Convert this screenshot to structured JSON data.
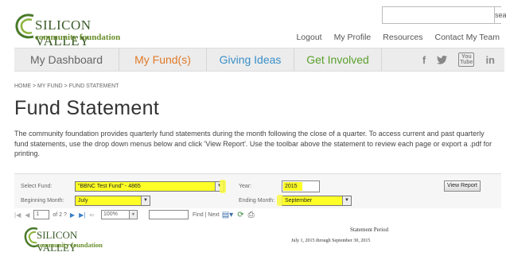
{
  "header": {
    "search_button": "search",
    "logo_line1": "SILICON VALLEY",
    "logo_line2": "community foundation",
    "top_links": [
      "Logout",
      "My Profile",
      "Resources",
      "Contact My Team"
    ]
  },
  "nav": {
    "items": [
      "My Dashboard",
      "My Fund(s)",
      "Giving Ideas",
      "Get Involved"
    ],
    "social": [
      "facebook-icon",
      "twitter-icon",
      "youtube-icon",
      "linkedin-icon"
    ]
  },
  "breadcrumb": "HOME > MY FUND > FUND STATEMENT",
  "page": {
    "title": "Fund Statement",
    "intro": "The community foundation provides quarterly fund statements during the month following the close of a quarter.  To access current and past quarterly fund statements, use the drop down menus below and click 'View Report'.  Use the toolbar above the statement to review each page or export a .pdf for printing."
  },
  "form": {
    "select_fund_label": "Select Fund:",
    "select_fund_value": "\"BBNC Test Fund\" - 4865",
    "year_label": "Year:",
    "year_value": "2015",
    "beginning_month_label": "Beginning Month:",
    "beginning_month_value": "July",
    "ending_month_label": "Ending Month:",
    "ending_month_value": "September",
    "view_report": "View Report",
    "highlight_color": "#ffff28"
  },
  "toolbar": {
    "page_value": "1",
    "page_of": "of 2 ?",
    "zoom_value": "100%",
    "find_next": "Find | Next"
  },
  "report": {
    "logo_line1": "SILICON VALLEY",
    "logo_line2": "community foundation",
    "period_title": "Statement Period",
    "period_range": "July 1, 2015 through September 30, 2015"
  }
}
